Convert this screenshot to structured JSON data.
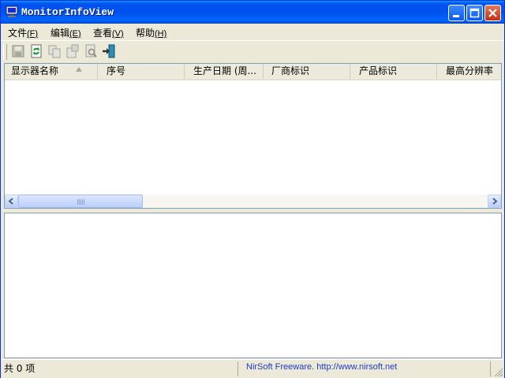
{
  "window": {
    "title": "MonitorInfoView"
  },
  "menu": [
    {
      "label": "文件",
      "key": "(F)"
    },
    {
      "label": "编辑",
      "key": "(E)"
    },
    {
      "label": "查看",
      "key": "(V)"
    },
    {
      "label": "帮助",
      "key": "(H)"
    }
  ],
  "toolbar": {
    "icons": [
      "save-icon",
      "refresh-icon",
      "copy-icon",
      "properties-icon",
      "find-icon",
      "exit-icon"
    ]
  },
  "list": {
    "columns": [
      "显示器名称",
      "序号",
      "生产日期 (周...",
      "厂商标识",
      "产品标识",
      "最高分辨率"
    ],
    "rows": []
  },
  "status": {
    "count": "共 0 项",
    "link": "NirSoft Freeware.  http://www.nirsoft.net"
  },
  "colors": {
    "titlebar": "#0054e3",
    "link": "#1a3cc8",
    "chrome": "#ece9d8"
  }
}
